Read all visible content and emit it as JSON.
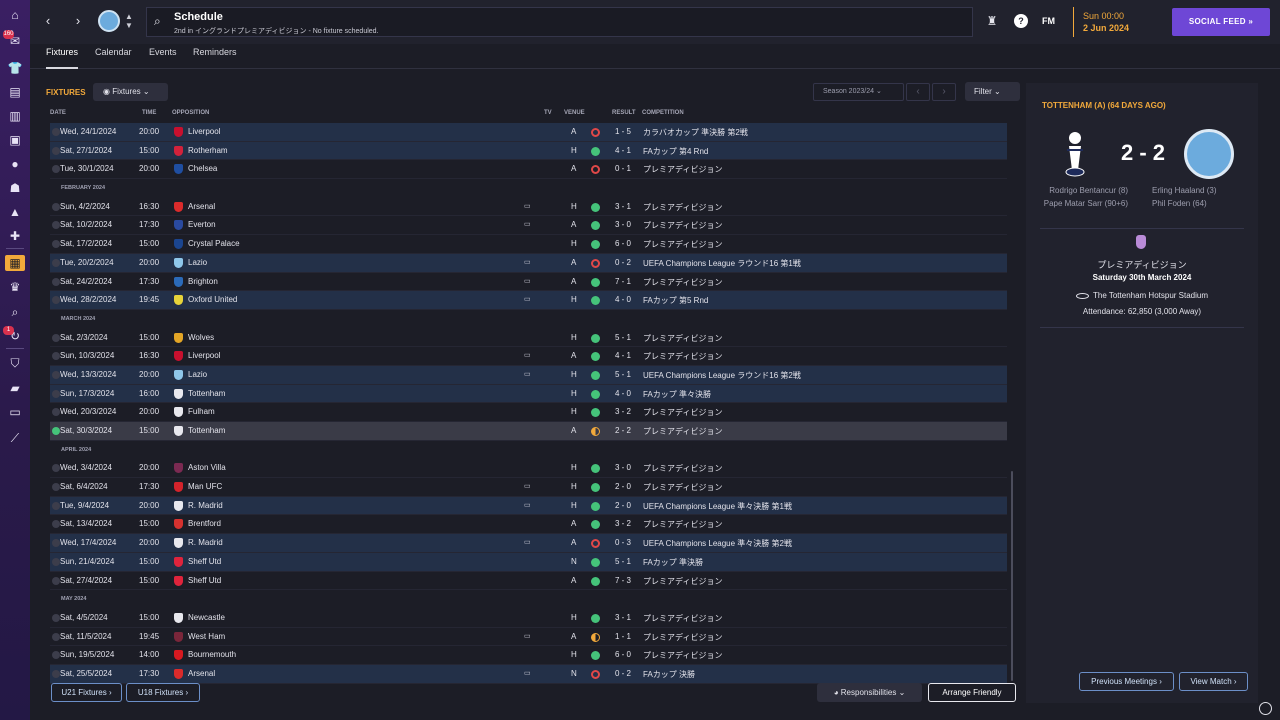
{
  "sidebar": {
    "icons": [
      "home-icon",
      "inbox-icon",
      "squad-icon",
      "tactics-icon",
      "data-hub-icon",
      "staff-icon",
      "training-icon",
      "medical-icon",
      "scouting-icon",
      "transfers-icon",
      "finances-icon",
      "schedule-icon",
      "competitions-icon",
      "search-icon",
      "dev-centre-icon",
      "club-info-icon",
      "club-vision-icon",
      "report-icon",
      "settings-icon"
    ],
    "badges": {
      "inbox": "160",
      "dev_centre": "1"
    }
  },
  "topbar": {
    "title": "Schedule",
    "subtitle": "2nd in イングランドプレミアディビジョン - No fixture scheduled.",
    "fm_logo": "FM",
    "date_time": "Sun 00:00",
    "date_day": "2 Jun 2024",
    "social_feed": "SOCIAL FEED"
  },
  "tabs": [
    "Fixtures",
    "Calendar",
    "Events",
    "Reminders"
  ],
  "fixtures": {
    "heading": "FIXTURES",
    "view_dropdown": "Fixtures",
    "season": "Season 2023/24",
    "filter": "Filter",
    "columns": {
      "date": "DATE",
      "time": "TIME",
      "opposition": "OPPOSITION",
      "tv": "TV",
      "venue": "VENUE",
      "result": "RESULT",
      "competition": "COMPETITION"
    },
    "rows": [
      {
        "type": "fixture",
        "date": "Wed, 24/1/2024",
        "time": "20:00",
        "opp": "Liverpool",
        "crest": "#c8102e",
        "tv": "",
        "venue": "A",
        "outcome": "L",
        "result": "1 - 5",
        "comp": "カラバオカップ 準決勝 第2戦",
        "hl": true
      },
      {
        "type": "fixture",
        "date": "Sat, 27/1/2024",
        "time": "15:00",
        "opp": "Rotherham",
        "crest": "#d3223b",
        "tv": "",
        "venue": "H",
        "outcome": "W",
        "result": "4 - 1",
        "comp": "FAカップ 第4 Rnd",
        "hl": true
      },
      {
        "type": "fixture",
        "date": "Tue, 30/1/2024",
        "time": "20:00",
        "opp": "Chelsea",
        "crest": "#1f4ea1",
        "tv": "",
        "venue": "A",
        "outcome": "L",
        "result": "0 - 1",
        "comp": "プレミアディビジョン",
        "hl": false
      },
      {
        "type": "month",
        "label": "FEBRUARY 2024"
      },
      {
        "type": "fixture",
        "date": "Sun, 4/2/2024",
        "time": "16:30",
        "opp": "Arsenal",
        "crest": "#db2b2b",
        "tv": "▭",
        "venue": "H",
        "outcome": "W",
        "result": "3 - 1",
        "comp": "プレミアディビジョン",
        "hl": false
      },
      {
        "type": "fixture",
        "date": "Sat, 10/2/2024",
        "time": "17:30",
        "opp": "Everton",
        "crest": "#2a4a9f",
        "tv": "▭",
        "venue": "A",
        "outcome": "W",
        "result": "3 - 0",
        "comp": "プレミアディビジョン",
        "hl": false
      },
      {
        "type": "fixture",
        "date": "Sat, 17/2/2024",
        "time": "15:00",
        "opp": "Crystal Palace",
        "crest": "#1b458f",
        "tv": "",
        "venue": "H",
        "outcome": "W",
        "result": "6 - 0",
        "comp": "プレミアディビジョン",
        "hl": false
      },
      {
        "type": "fixture",
        "date": "Tue, 20/2/2024",
        "time": "20:00",
        "opp": "Lazio",
        "crest": "#8fc7ea",
        "tv": "▭",
        "venue": "A",
        "outcome": "L",
        "result": "0 - 2",
        "comp": "UEFA Champions League ラウンド16 第1戦",
        "hl": true
      },
      {
        "type": "fixture",
        "date": "Sat, 24/2/2024",
        "time": "17:30",
        "opp": "Brighton",
        "crest": "#2b6ab8",
        "tv": "▭",
        "venue": "A",
        "outcome": "W",
        "result": "7 - 1",
        "comp": "プレミアディビジョン",
        "hl": false
      },
      {
        "type": "fixture",
        "date": "Wed, 28/2/2024",
        "time": "19:45",
        "opp": "Oxford United",
        "crest": "#e6d33a",
        "tv": "▭",
        "venue": "H",
        "outcome": "W",
        "result": "4 - 0",
        "comp": "FAカップ 第5 Rnd",
        "hl": true
      },
      {
        "type": "month",
        "label": "MARCH 2024"
      },
      {
        "type": "fixture",
        "date": "Sat, 2/3/2024",
        "time": "15:00",
        "opp": "Wolves",
        "crest": "#e3a526",
        "tv": "",
        "venue": "H",
        "outcome": "W",
        "result": "5 - 1",
        "comp": "プレミアディビジョン",
        "hl": false
      },
      {
        "type": "fixture",
        "date": "Sun, 10/3/2024",
        "time": "16:30",
        "opp": "Liverpool",
        "crest": "#c8102e",
        "tv": "▭",
        "venue": "A",
        "outcome": "W",
        "result": "4 - 1",
        "comp": "プレミアディビジョン",
        "hl": false
      },
      {
        "type": "fixture",
        "date": "Wed, 13/3/2024",
        "time": "20:00",
        "opp": "Lazio",
        "crest": "#8fc7ea",
        "tv": "▭",
        "venue": "H",
        "outcome": "W",
        "result": "5 - 1",
        "comp": "UEFA Champions League ラウンド16 第2戦",
        "hl": true
      },
      {
        "type": "fixture",
        "date": "Sun, 17/3/2024",
        "time": "16:00",
        "opp": "Tottenham",
        "crest": "#e8e8ee",
        "tv": "",
        "venue": "H",
        "outcome": "W",
        "result": "4 - 0",
        "comp": "FAカップ 準々決勝",
        "hl": true
      },
      {
        "type": "fixture",
        "date": "Wed, 20/3/2024",
        "time": "20:00",
        "opp": "Fulham",
        "crest": "#e8e8ee",
        "tv": "",
        "venue": "H",
        "outcome": "W",
        "result": "3 - 2",
        "comp": "プレミアディビジョン",
        "hl": false
      },
      {
        "type": "fixture",
        "date": "Sat, 30/3/2024",
        "time": "15:00",
        "opp": "Tottenham",
        "crest": "#e8e8ee",
        "tv": "",
        "venue": "A",
        "outcome": "D",
        "result": "2 - 2",
        "comp": "プレミアディビジョン",
        "hl": false,
        "sel": true
      },
      {
        "type": "month",
        "label": "APRIL 2024"
      },
      {
        "type": "fixture",
        "date": "Wed, 3/4/2024",
        "time": "20:00",
        "opp": "Aston Villa",
        "crest": "#7b2a52",
        "tv": "",
        "venue": "H",
        "outcome": "W",
        "result": "3 - 0",
        "comp": "プレミアディビジョン",
        "hl": false
      },
      {
        "type": "fixture",
        "date": "Sat, 6/4/2024",
        "time": "17:30",
        "opp": "Man UFC",
        "crest": "#d4232b",
        "tv": "▭",
        "venue": "H",
        "outcome": "W",
        "result": "2 - 0",
        "comp": "プレミアディビジョン",
        "hl": false
      },
      {
        "type": "fixture",
        "date": "Tue, 9/4/2024",
        "time": "20:00",
        "opp": "R. Madrid",
        "crest": "#e8e8ee",
        "tv": "▭",
        "venue": "H",
        "outcome": "W",
        "result": "2 - 0",
        "comp": "UEFA Champions League 準々決勝 第1戦",
        "hl": true
      },
      {
        "type": "fixture",
        "date": "Sat, 13/4/2024",
        "time": "15:00",
        "opp": "Brentford",
        "crest": "#d6322f",
        "tv": "",
        "venue": "A",
        "outcome": "W",
        "result": "3 - 2",
        "comp": "プレミアディビジョン",
        "hl": false
      },
      {
        "type": "fixture",
        "date": "Wed, 17/4/2024",
        "time": "20:00",
        "opp": "R. Madrid",
        "crest": "#e8e8ee",
        "tv": "▭",
        "venue": "A",
        "outcome": "L",
        "result": "0 - 3",
        "comp": "UEFA Champions League 準々決勝 第2戦",
        "hl": true
      },
      {
        "type": "fixture",
        "date": "Sun, 21/4/2024",
        "time": "15:00",
        "opp": "Sheff Utd",
        "crest": "#e0243c",
        "tv": "",
        "venue": "N",
        "outcome": "W",
        "result": "5 - 1",
        "comp": "FAカップ 準決勝",
        "hl": true
      },
      {
        "type": "fixture",
        "date": "Sat, 27/4/2024",
        "time": "15:00",
        "opp": "Sheff Utd",
        "crest": "#e0243c",
        "tv": "",
        "venue": "A",
        "outcome": "W",
        "result": "7 - 3",
        "comp": "プレミアディビジョン",
        "hl": false
      },
      {
        "type": "month",
        "label": "MAY 2024"
      },
      {
        "type": "fixture",
        "date": "Sat, 4/5/2024",
        "time": "15:00",
        "opp": "Newcastle",
        "crest": "#e8e8ee",
        "tv": "",
        "venue": "H",
        "outcome": "W",
        "result": "3 - 1",
        "comp": "プレミアディビジョン",
        "hl": false
      },
      {
        "type": "fixture",
        "date": "Sat, 11/5/2024",
        "time": "19:45",
        "opp": "West Ham",
        "crest": "#7a263a",
        "tv": "▭",
        "venue": "A",
        "outcome": "D",
        "result": "1 - 1",
        "comp": "プレミアディビジョン",
        "hl": false
      },
      {
        "type": "fixture",
        "date": "Sun, 19/5/2024",
        "time": "14:00",
        "opp": "Bournemouth",
        "crest": "#d71920",
        "tv": "",
        "venue": "H",
        "outcome": "W",
        "result": "6 - 0",
        "comp": "プレミアディビジョン",
        "hl": false
      },
      {
        "type": "fixture",
        "date": "Sat, 25/5/2024",
        "time": "17:30",
        "opp": "Arsenal",
        "crest": "#db2b2b",
        "tv": "▭",
        "venue": "N",
        "outcome": "L",
        "result": "0 - 2",
        "comp": "FAカップ 決勝",
        "hl": true
      }
    ],
    "footer": {
      "u21": "U21 Fixtures",
      "u18": "U18 Fixtures",
      "responsibilities": "Responsibilities",
      "arrange": "Arrange Friendly"
    }
  },
  "match": {
    "title": "TOTTENHAM (A) (64 DAYS AGO)",
    "score": "2 - 2",
    "home_scorers": [
      "Rodrigo Bentancur (8)",
      "Pape Matar Sarr (90+6)"
    ],
    "away_scorers": [
      "Erling Haaland (3)",
      "Phil Foden (64)"
    ],
    "league": "プレミアディビジョン",
    "date": "Saturday 30th March 2024",
    "stadium": "The Tottenham Hotspur Stadium",
    "attendance": "Attendance: 62,850 (3,000 Away)",
    "prev_meetings": "Previous Meetings",
    "view_match": "View Match"
  },
  "colors": {
    "accent": "#f2a93b",
    "win": "#45c37a",
    "loss": "#e04848",
    "highlight_row": "#233048",
    "social": "#6e47d6"
  }
}
